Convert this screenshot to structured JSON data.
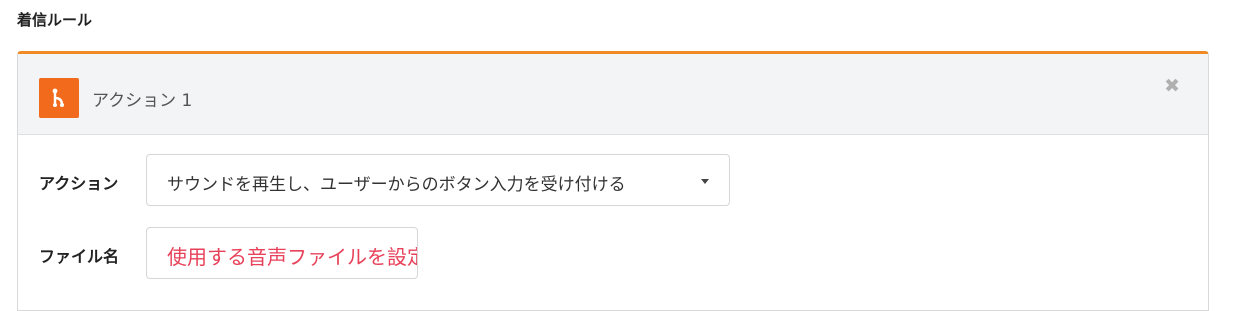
{
  "section": {
    "title": "着信ルール"
  },
  "panel": {
    "accent_color": "#f08a24",
    "icon": {
      "name": "branch-icon",
      "color": "#f26b1d"
    },
    "title": "アクション 1",
    "close_glyph": "✖"
  },
  "form": {
    "action": {
      "label": "アクション",
      "selected": "サウンドを再生し、ユーザーからのボタン入力を受け付ける"
    },
    "file": {
      "label": "ファイル名",
      "link_text": "使用する音声ファイルを設定",
      "link_color": "#e8425a"
    }
  }
}
